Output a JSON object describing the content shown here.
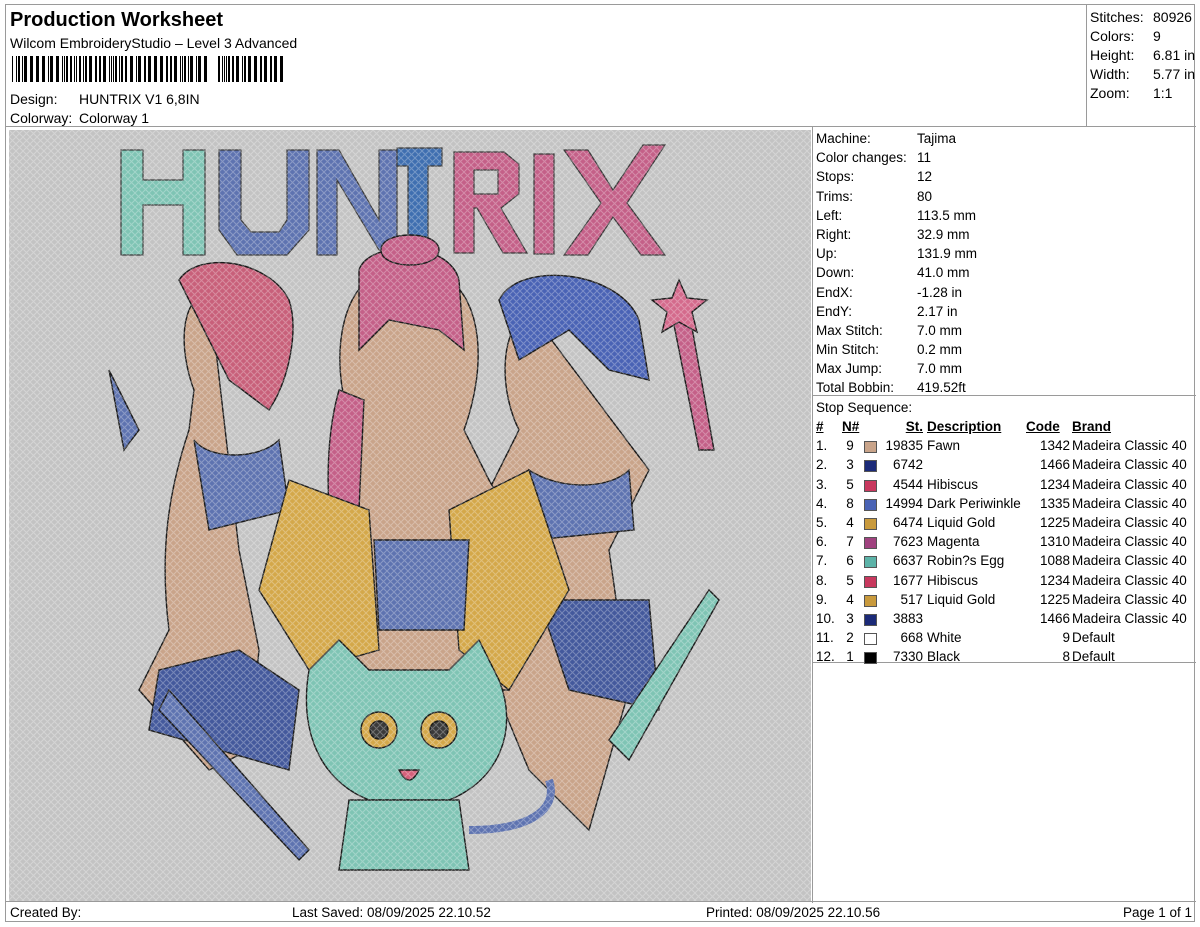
{
  "header": {
    "title": "Production Worksheet",
    "subtitle": "Wilcom EmbroideryStudio – Level 3 Advanced",
    "design_label": "Design:",
    "design_value": "HUNTRIX V1 6,8IN",
    "colorway_label": "Colorway:",
    "colorway_value": "Colorway 1"
  },
  "summary": [
    {
      "key": "Stitches:",
      "value": "80926"
    },
    {
      "key": "Colors:",
      "value": "9"
    },
    {
      "key": "Height:",
      "value": "6.81 in"
    },
    {
      "key": "Width:",
      "value": "5.77 in"
    },
    {
      "key": "Zoom:",
      "value": "1:1"
    }
  ],
  "design_image": {
    "title_text": "HUNTRIX",
    "title_letter_colors": [
      "#7fc4b4",
      "#5e73b0",
      "#5e73b0",
      "#3f6fb0",
      "#c46088",
      "#c46088",
      "#c46088"
    ]
  },
  "machine": [
    {
      "key": "Machine:",
      "value": "Tajima"
    },
    {
      "key": "Color changes:",
      "value": "11"
    },
    {
      "key": "Stops:",
      "value": "12"
    },
    {
      "key": "Trims:",
      "value": "80"
    },
    {
      "key": "Left:",
      "value": "113.5 mm"
    },
    {
      "key": "Right:",
      "value": "32.9 mm"
    },
    {
      "key": "Up:",
      "value": "131.9 mm"
    },
    {
      "key": "Down:",
      "value": "41.0 mm"
    },
    {
      "key": "EndX:",
      "value": "-1.28 in"
    },
    {
      "key": "EndY:",
      "value": "2.17 in"
    },
    {
      "key": "Max Stitch:",
      "value": "7.0 mm"
    },
    {
      "key": "Min Stitch:",
      "value": "0.2 mm"
    },
    {
      "key": "Max Jump:",
      "value": "7.0 mm"
    },
    {
      "key": "Total Bobbin:",
      "value": "419.52ft"
    }
  ],
  "stop_sequence": {
    "title": "Stop Sequence:",
    "headers": {
      "num": "#",
      "n": "N#",
      "st": "St.",
      "desc": "Description",
      "code": "Code",
      "brand": "Brand"
    },
    "rows": [
      {
        "num": "1.",
        "n": "9",
        "color": "#c9a48a",
        "st": "19835",
        "desc": "Fawn",
        "code": "1342",
        "brand": "Madeira Classic 40"
      },
      {
        "num": "2.",
        "n": "3",
        "color": "#1b2a78",
        "st": "6742",
        "desc": "",
        "code": "1466",
        "brand": "Madeira Classic 40"
      },
      {
        "num": "3.",
        "n": "5",
        "color": "#c8385e",
        "st": "4544",
        "desc": "Hibiscus",
        "code": "1234",
        "brand": "Madeira Classic 40"
      },
      {
        "num": "4.",
        "n": "8",
        "color": "#4a63b5",
        "st": "14994",
        "desc": "Dark Periwinkle",
        "code": "1335",
        "brand": "Madeira Classic 40"
      },
      {
        "num": "5.",
        "n": "4",
        "color": "#c99a3c",
        "st": "6474",
        "desc": "Liquid Gold",
        "code": "1225",
        "brand": "Madeira Classic 40"
      },
      {
        "num": "6.",
        "n": "7",
        "color": "#a0427f",
        "st": "7623",
        "desc": "Magenta",
        "code": "1310",
        "brand": "Madeira Classic 40"
      },
      {
        "num": "7.",
        "n": "6",
        "color": "#5cb3a8",
        "st": "6637",
        "desc": "Robin?s Egg",
        "code": "1088",
        "brand": "Madeira Classic 40"
      },
      {
        "num": "8.",
        "n": "5",
        "color": "#c8385e",
        "st": "1677",
        "desc": "Hibiscus",
        "code": "1234",
        "brand": "Madeira Classic 40"
      },
      {
        "num": "9.",
        "n": "4",
        "color": "#c99a3c",
        "st": "517",
        "desc": "Liquid Gold",
        "code": "1225",
        "brand": "Madeira Classic 40"
      },
      {
        "num": "10.",
        "n": "3",
        "color": "#1b2a78",
        "st": "3883",
        "desc": "",
        "code": "1466",
        "brand": "Madeira Classic 40"
      },
      {
        "num": "11.",
        "n": "2",
        "color": "#ffffff",
        "st": "668",
        "desc": "White",
        "code": "9",
        "brand": "Default"
      },
      {
        "num": "12.",
        "n": "1",
        "color": "#000000",
        "st": "7330",
        "desc": "Black",
        "code": "8",
        "brand": "Default"
      }
    ]
  },
  "footer": {
    "created_by": "Created By:",
    "last_saved": "Last Saved: 08/09/2025 22.10.52",
    "printed": "Printed: 08/09/2025 22.10.56",
    "page": "Page 1 of 1"
  }
}
